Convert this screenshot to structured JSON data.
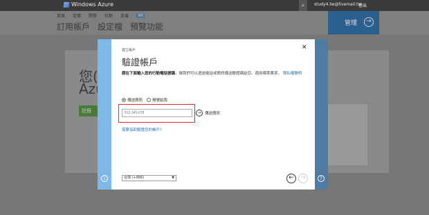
{
  "topbar": {
    "brand": "Windows Azure",
    "account": "study4.tw@livemail.tw",
    "signout": "登出"
  },
  "portal": {
    "nav": [
      "首頁",
      "定價",
      "開發",
      "社群",
      "支援"
    ],
    "preview_badge": "預覽",
    "big_nav": [
      "訂用帳戶",
      "設定檔",
      "預覽功能"
    ],
    "manage": "管理"
  },
  "background_card": {
    "heading1": "您(",
    "heading2": "Azu",
    "button": "註冊"
  },
  "dialog": {
    "breadcrumb": "建立帳戶",
    "title": "驗證帳戶",
    "desc_bold": "請在下面輸入您的行動電話號碼",
    "desc_rest": "，讓我們可以透過電話或簡訊傳送驗證碼給您。適用標準費率。",
    "desc_link": "隱私權聲明",
    "radio_sms": "傳送簡訊",
    "radio_call": "撥號給我",
    "phone_placeholder": "812-345-678",
    "send_label": "傳送簡訊",
    "help_link": "需要協助驗證您的帳戶？",
    "country": "台灣 (+886)"
  },
  "colors": {
    "highlight": "#d92b2b",
    "link": "#2a77b8",
    "left_panel": "#7db8e8",
    "right_panel": "#4f7ba3"
  }
}
